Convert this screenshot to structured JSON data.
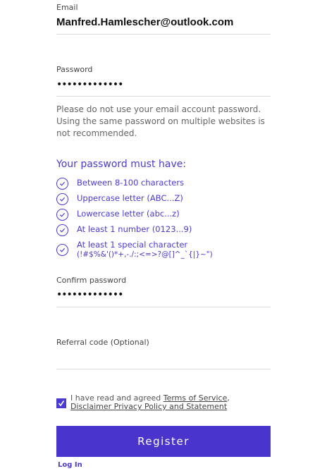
{
  "email": {
    "label": "Email",
    "value": "Manfred.Hamlescher@outlook.com"
  },
  "password": {
    "label": "Password",
    "value": "•••••••••••••"
  },
  "hint": "Please do not use your email account password. Using the same password on multiple websites is not recommended.",
  "rules": {
    "title": "Your password must have:",
    "items": [
      "Between 8-100 characters",
      "Uppercase letter (ABC...Z)",
      "Lowercase letter (abc...z)",
      "At least 1 number (0123...9)",
      "At least 1 special character",
      "(!#$%&'()*+,-./:;<=>?@[]^_`{|}~\")"
    ]
  },
  "confirm": {
    "label": "Confirm password",
    "value": "•••••••••••••"
  },
  "referral": {
    "label": "Referral code (Optional)",
    "value": ""
  },
  "agree": {
    "checked": true,
    "prefix": "I have read and agreed",
    "terms_link": "Terms of Service",
    "comma": ",",
    "privacy_link": "Disclaimer Privacy Policy and Statement"
  },
  "register_label": "Register",
  "login_label": "Log In",
  "colors": {
    "accent": "#4a35cc"
  }
}
